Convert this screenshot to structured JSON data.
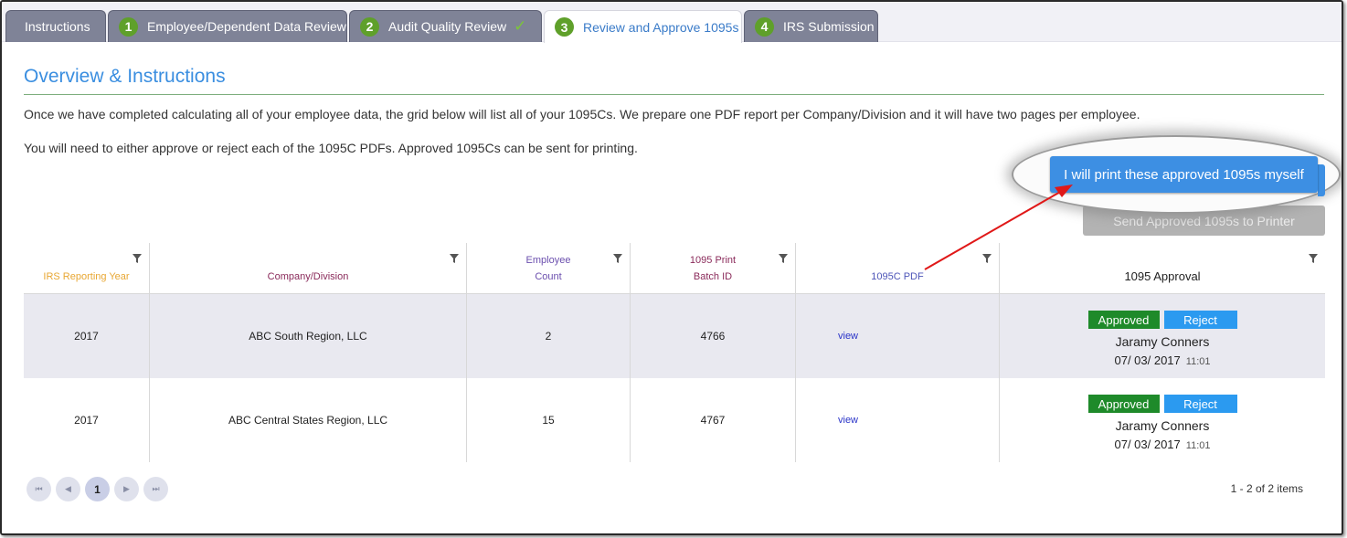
{
  "tabs": [
    {
      "label": "Instructions",
      "number": "",
      "state": "default"
    },
    {
      "label": "Employee/Dependent Data Review",
      "number": "1",
      "state": "default"
    },
    {
      "label": "Audit Quality Review",
      "number": "2",
      "state": "done"
    },
    {
      "label": "Review and Approve 1095s",
      "number": "3",
      "state": "active"
    },
    {
      "label": "IRS Submission",
      "number": "4",
      "state": "default"
    }
  ],
  "overview": {
    "title": "Overview & Instructions",
    "paragraph1": "Once we have completed calculating all of your employee data, the grid below will list all of your 1095Cs. We prepare one PDF report per Company/Division and it will have two pages per employee.",
    "paragraph2": "You will need to either approve or reject each of the 1095C PDFs. Approved 1095Cs can be sent for printing."
  },
  "actions": {
    "print_myself": "I will print these approved 1095s myself",
    "send_printer": "Send Approved 1095s to Printer"
  },
  "grid": {
    "headers": {
      "year": "IRS Reporting Year",
      "company": "Company/Division",
      "count_l1": "Employee",
      "count_l2": "Count",
      "batch_l1": "1095 Print",
      "batch_l2": "Batch ID",
      "pdf": "1095C PDF",
      "approval": "1095 Approval"
    },
    "header_colors": {
      "year": "#e8a733",
      "company": "#8a2a5a",
      "count": "#6b4fae",
      "batch": "#8a2a5a",
      "pdf": "#4e56b8",
      "approval": "#222222"
    },
    "rows": [
      {
        "year": "2017",
        "company": "ABC South Region, LLC",
        "count": "2",
        "batch": "4766",
        "pdf": "view",
        "approved": "Approved",
        "reject": "Reject",
        "approver": "Jaramy Conners",
        "date": "07/ 03/ 2017",
        "time": "11:01"
      },
      {
        "year": "2017",
        "company": "ABC Central States Region, LLC",
        "count": "15",
        "batch": "4767",
        "pdf": "view",
        "approved": "Approved",
        "reject": "Reject",
        "approver": "Jaramy Conners",
        "date": "07/ 03/ 2017",
        "time": "11:01"
      }
    ]
  },
  "pager": {
    "first": "⏮",
    "prev": "◀",
    "current": "1",
    "next": "▶",
    "last": "⏭",
    "summary": "1 - 2 of 2 items"
  },
  "icons": {
    "filter": "filter-icon",
    "check": "checkmark-icon"
  },
  "colors": {
    "accent": "#3d8fe3",
    "approved": "#1e8a2a",
    "reject": "#2b9af0",
    "step": "#5fa02a",
    "annotation_arrow": "#e01818"
  }
}
